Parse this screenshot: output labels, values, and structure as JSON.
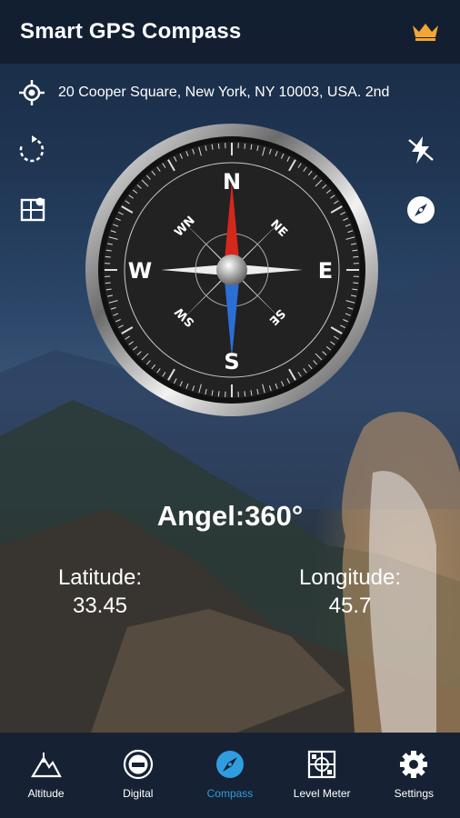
{
  "header": {
    "title": "Smart GPS Compass",
    "premium_icon": "crown-icon"
  },
  "location": {
    "icon": "gps-target-icon",
    "address": "20 Cooper Square, New York, NY 10003, USA. 2nd"
  },
  "side_buttons": {
    "left": [
      "refresh-icon",
      "map-icon"
    ],
    "right": [
      "flash-icon",
      "compass-small-icon"
    ]
  },
  "compass": {
    "cardinals": {
      "n": "N",
      "e": "E",
      "s": "S",
      "w": "W"
    },
    "intercardinals": {
      "ne": "NE",
      "se": "SE",
      "sw": "SW",
      "nw": "WN"
    }
  },
  "readings": {
    "angle": "Angel:360°",
    "latitude_label": "Latitude:",
    "latitude_value": "33.45",
    "longitude_label": "Longitude:",
    "longitude_value": "45.7"
  },
  "nav": [
    {
      "label": "Altitude",
      "icon": "mountain-icon"
    },
    {
      "label": "Digital",
      "icon": "digital-dial-icon"
    },
    {
      "label": "Compass",
      "icon": "compass-icon",
      "active": true
    },
    {
      "label": "Level Meter",
      "icon": "level-meter-icon"
    },
    {
      "label": "Settings",
      "icon": "gear-icon"
    }
  ],
  "colors": {
    "accent": "#2f9de0",
    "crown": "#f4a534",
    "needle_north": "#d5281d",
    "needle_south": "#2a6fd6"
  }
}
